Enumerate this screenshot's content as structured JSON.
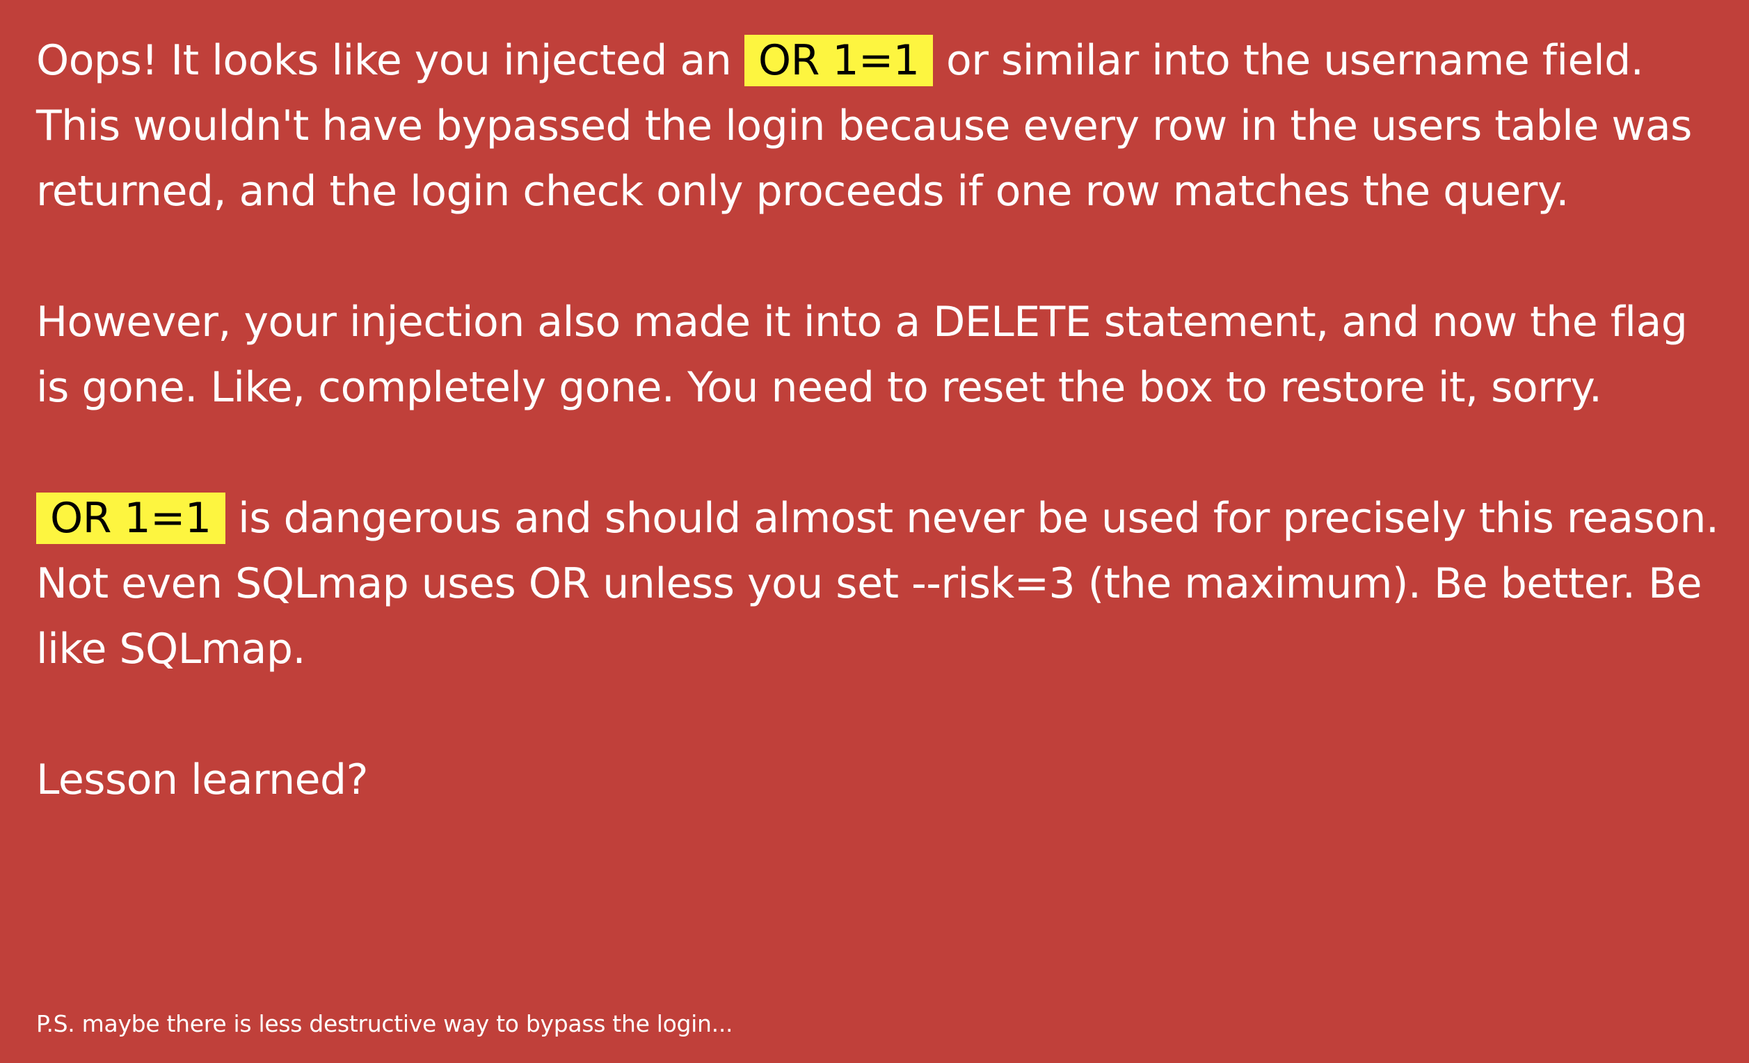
{
  "colors": {
    "background": "#c0403a",
    "text": "#ffffff",
    "highlight": "#fdf540",
    "highlight_text": "#000000"
  },
  "message": {
    "p1": {
      "before": "Oops! It looks like you injected an ",
      "code": "OR 1=1",
      "after": " or similar into the username field. This wouldn't have bypassed the login because every row in the users table was returned, and the login check only proceeds if one row matches the query."
    },
    "p2": {
      "text": "However, your injection also made it into a DELETE statement, and now the flag is gone. Like, completely gone. You need to reset the box to restore it, sorry."
    },
    "p3": {
      "code": "OR 1=1",
      "after": " is dangerous and should almost never be used for precisely this reason. Not even SQLmap uses OR unless you set --risk=3 (the maximum). Be better. Be like SQLmap."
    },
    "p4": {
      "text": "Lesson learned?"
    }
  },
  "footnote": {
    "text": "P.S. maybe there is less destructive way to bypass the login..."
  }
}
